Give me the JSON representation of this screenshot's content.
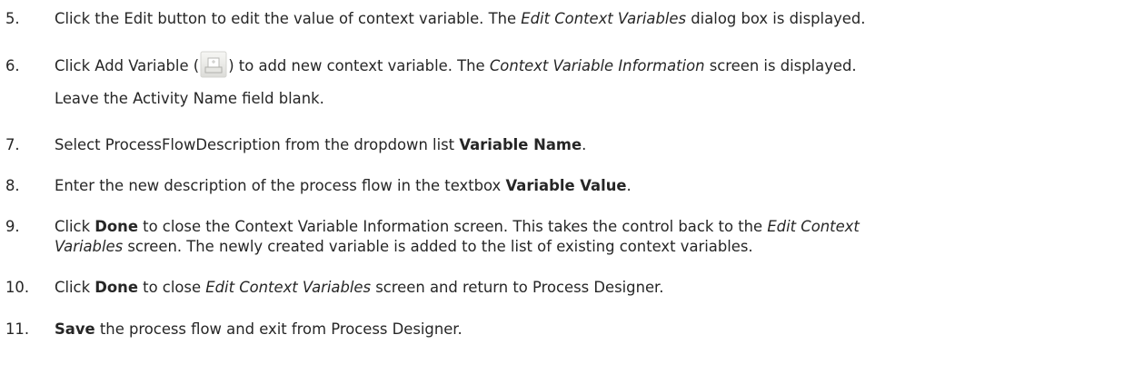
{
  "steps": [
    {
      "number": "5.",
      "parts": [
        "Click the Edit button to edit the value of context variable. The ",
        "Edit Context Variables",
        " dialog box is displayed."
      ]
    },
    {
      "number": "6.",
      "parts": [
        "Click Add Variable (",
        ") to add new context variable. The ",
        "Context Variable Information",
        " screen is displayed."
      ],
      "icon": "add-variable-icon",
      "continuation": "Leave the Activity Name field blank."
    },
    {
      "number": "7.",
      "parts": [
        "Select ProcessFlowDescription from the dropdown list ",
        "Variable Name",
        "."
      ]
    },
    {
      "number": "8.",
      "parts": [
        "Enter the new description of the process flow in the textbox ",
        "Variable Value",
        "."
      ]
    },
    {
      "number": "9.",
      "parts": [
        "Click ",
        "Done",
        " to close the Context Variable Information screen. This takes the control back to the ",
        "Edit Context"
      ],
      "line2_parts": [
        "Variables",
        " screen. The newly created variable is added to the list of existing context variables."
      ]
    },
    {
      "number": "10.",
      "parts": [
        "Click ",
        "Done",
        " to close ",
        "Edit Context Variables",
        " screen and return to Process Designer."
      ]
    },
    {
      "number": "11.",
      "parts": [
        "Save",
        " the process flow and exit from Process Designer."
      ]
    }
  ]
}
